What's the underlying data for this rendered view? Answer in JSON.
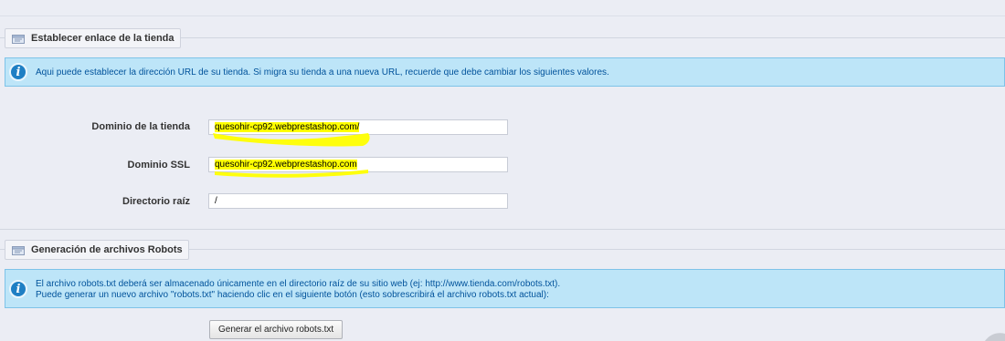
{
  "store_section": {
    "title": "Establecer enlace de la tienda",
    "info": "Aqui puede establecer la dirección URL de su tienda. Si migra su tienda a una nueva URL, recuerde que debe cambiar los siguientes valores.",
    "fields": [
      {
        "label": "Dominio de la tienda",
        "value": "quesohir-cp92.webprestashop.com/"
      },
      {
        "label": "Dominio SSL",
        "value": "quesohir-cp92.webprestashop.com"
      },
      {
        "label": "Directorio raíz",
        "value": "/"
      }
    ]
  },
  "robots_section": {
    "title": "Generación de archivos Robots",
    "info_line1": "El archivo robots.txt deberá ser almacenado únicamente en el directorio raíz de su sitio web (ej: http://www.tienda.com/robots.txt).",
    "info_line2": "Puede generar un nuevo archivo \"robots.txt\" haciendo clic en el siguiente botón (esto sobrescribirá el archivo robots.txt actual):",
    "button_label": "Generar el archivo robots.txt"
  },
  "colors": {
    "highlight": "#ffff00",
    "info_bg": "#bde5f8",
    "info_text": "#00529b"
  },
  "icons": {
    "legend": "section-folder-icon",
    "info": "info-icon"
  }
}
